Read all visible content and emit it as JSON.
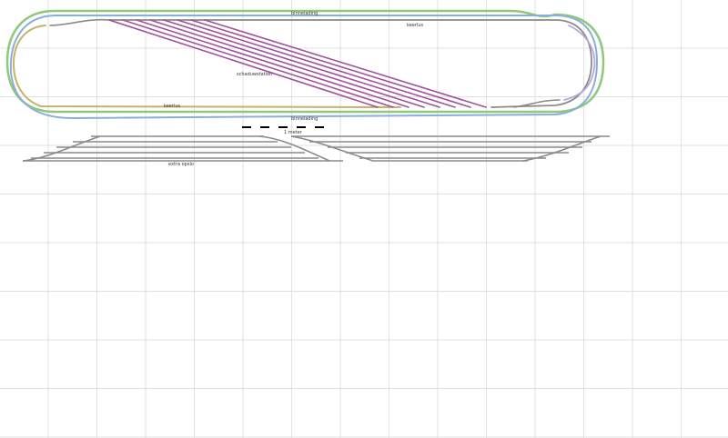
{
  "colors": {
    "background": "#ffffff",
    "grid": "#d6d6d6",
    "track_grey": "#8a8a8a",
    "track_grey_dark": "#666666",
    "track_green": "#8ec97a",
    "track_blue": "#8aaedb",
    "track_purple": "#a0529a",
    "track_lavender": "#b9a6dc",
    "track_tan": "#c9b06a",
    "scale_bar": "#000000"
  },
  "labels": {
    "top_loop": "binnelading",
    "top_right_line": "keerlus",
    "yard": "schaduwstation",
    "bottom_left_line": "keerlus",
    "bottom_loop": "binnelading",
    "scale": "1 meter",
    "bottom_yard": "extra opslo"
  }
}
